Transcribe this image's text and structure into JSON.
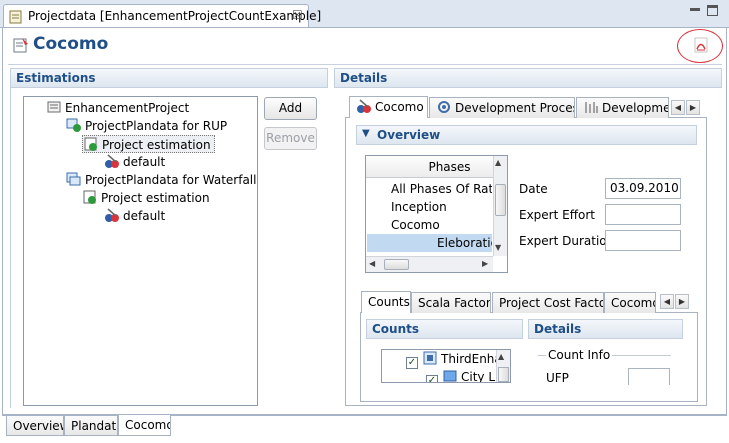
{
  "window": {
    "tab_title": "Projectdata [EnhancementProjectCountExample]",
    "close_glyph": "☒"
  },
  "editor": {
    "title": "Cocomo"
  },
  "estimations": {
    "header": "Estimations",
    "tree": [
      "EnhancementProject",
      "ProjectPlandata for RUP",
      "Project estimation",
      "default",
      "ProjectPlandata for Waterfall",
      "Project estimation",
      "default"
    ],
    "add_label": "Add",
    "remove_label": "Remove"
  },
  "details": {
    "header": "Details",
    "tabs": [
      "Cocomo",
      "Development Process",
      "Developmer"
    ],
    "overview_label": "Overview",
    "phases": {
      "header": "Phases",
      "rows": [
        "All Phases Of Ratio",
        "Inception",
        "Cocomo",
        "Eleboration"
      ],
      "selected_index": 3
    },
    "fields": {
      "date_label": "Date",
      "date_value": "03.09.2010",
      "effort_label": "Expert Effort",
      "effort_value": "",
      "duration_label": "Expert Duration",
      "duration_value": ""
    },
    "subtabs": [
      "Counts",
      "Scala Factors",
      "Project Cost Factor",
      "Cocomo"
    ],
    "counts": {
      "header": "Counts",
      "items": [
        "ThirdEnha",
        "City L"
      ]
    },
    "details_panel": {
      "header": "Details",
      "group_label": "Count Info",
      "ufp_label": "UFP"
    }
  },
  "bottom_tabs": [
    "Overview",
    "Plandata",
    "Cocomo"
  ],
  "colors": {
    "accent": "#1f4f86",
    "selection": "#c2d9f2",
    "annotation_circle": "#d9343b"
  }
}
